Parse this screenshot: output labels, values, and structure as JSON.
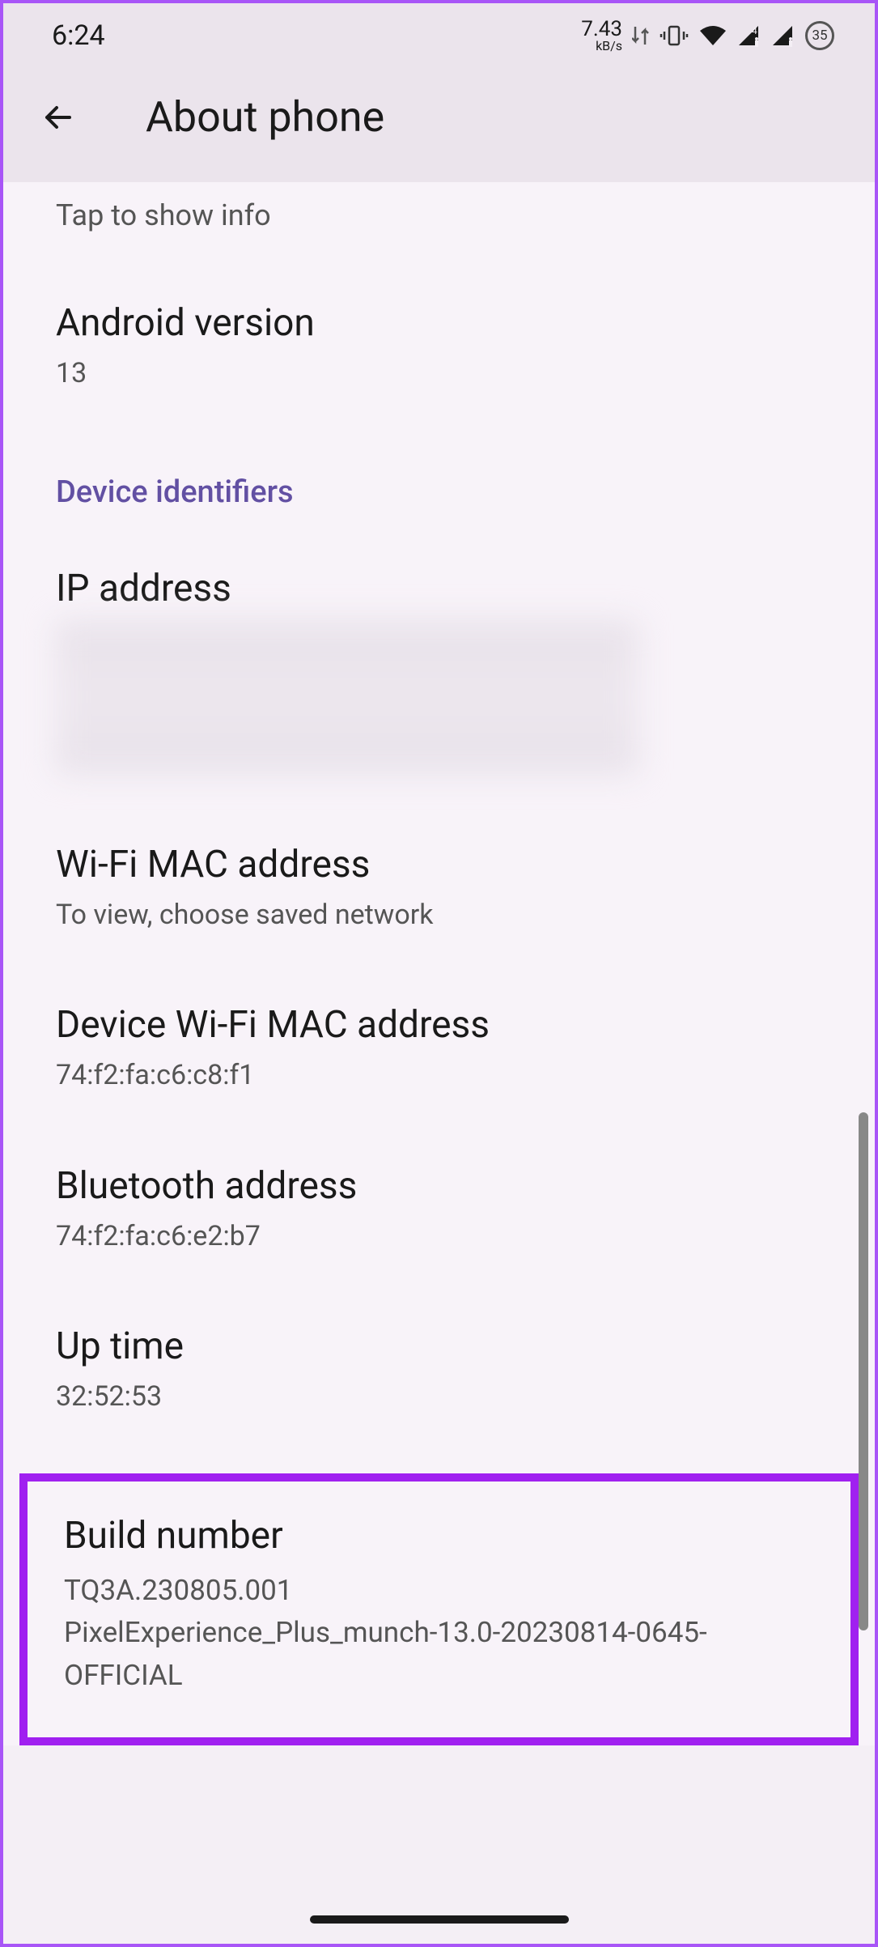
{
  "status_bar": {
    "time": "6:24",
    "net_speed_value": "7.43",
    "net_speed_unit": "kB/s",
    "battery_percent": "35"
  },
  "header": {
    "title": "About phone"
  },
  "content": {
    "tap_info": "Tap to show info",
    "android_version": {
      "title": "Android version",
      "value": "13"
    },
    "section_header": "Device identifiers",
    "ip_address": {
      "title": "IP address"
    },
    "wifi_mac": {
      "title": "Wi-Fi MAC address",
      "value": "To view, choose saved network"
    },
    "device_wifi_mac": {
      "title": "Device Wi-Fi MAC address",
      "value": "74:f2:fa:c6:c8:f1"
    },
    "bluetooth": {
      "title": "Bluetooth address",
      "value": "74:f2:fa:c6:e2:b7"
    },
    "uptime": {
      "title": "Up time",
      "value": "32:52:53"
    },
    "build": {
      "title": "Build number",
      "value": "TQ3A.230805.001\nPixelExperience_Plus_munch-13.0-20230814-0645-OFFICIAL"
    }
  }
}
